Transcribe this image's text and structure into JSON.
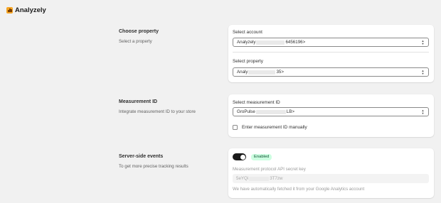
{
  "app": {
    "title": "Analyzely",
    "logo_icon": "bar-chart-icon",
    "logo_color": "#f5a524"
  },
  "property_section": {
    "title": "Choose property",
    "description": "Select a property",
    "account_label": "Select account",
    "account_value_prefix": "Analyzely",
    "account_value_suffix": "6456196>",
    "property_label": "Select property",
    "property_value_prefix": "Analy",
    "property_value_suffix": "35>"
  },
  "measurement_section": {
    "title": "Measurement ID",
    "description": "Integrate measurement ID to your store",
    "select_label": "Select measurement ID",
    "select_value_prefix": "GroPulse",
    "select_value_suffix": "LB>",
    "manual_checkbox_label": "Enter measurement ID manually",
    "manual_checked": false
  },
  "server_section": {
    "title": "Server-side events",
    "description": "To get more precise tracking results",
    "toggle_on": true,
    "status_badge": "Enabled",
    "badge_color": "#cdfee1",
    "secret_label": "Measurement protocol API secret key",
    "secret_value_prefix": "5eYQi",
    "secret_value_suffix": "3T7zw",
    "help_text": "We have automatically fetched it from your Google Analytics account"
  }
}
